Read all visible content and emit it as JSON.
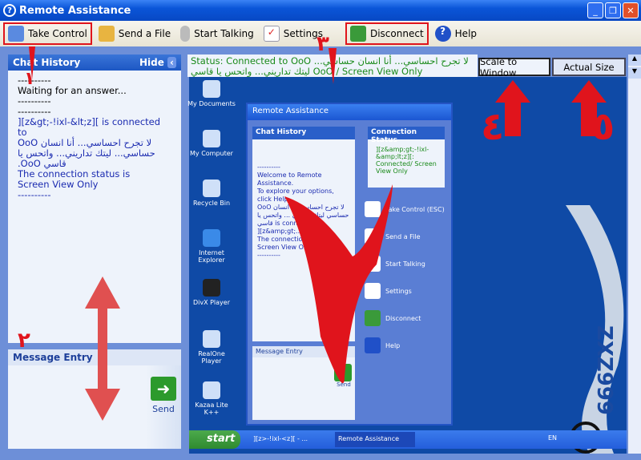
{
  "window": {
    "title": "Remote Assistance"
  },
  "toolbar": {
    "items": [
      {
        "label": "Take Control",
        "icon": "take-control-icon"
      },
      {
        "label": "Send a File",
        "icon": "send-file-icon"
      },
      {
        "label": "Start Talking",
        "icon": "microphone-icon"
      },
      {
        "label": "Settings",
        "icon": "settings-icon"
      },
      {
        "label": "Disconnect",
        "icon": "disconnect-icon"
      },
      {
        "label": "Help",
        "icon": "help-icon"
      }
    ]
  },
  "chat": {
    "title": "Chat History",
    "hide": "Hide",
    "lines": [
      "----------",
      "Waiting for an answer...",
      "----------",
      "----------"
    ],
    "blue_lines": [
      "][z&gt;-!ixl-&lt;z][ is connected to",
      "لا تجرح احساسي... أنا انسان OoO",
      "حساسي... ليتك تداريني... واتحس يا",
      "قاسي OoO.",
      "The connection status is",
      "Screen View Only"
    ],
    "end": "----------"
  },
  "message_entry": {
    "title": "Message Entry",
    "send": "Send"
  },
  "status": {
    "text": "Status: Connected to OoO لا تجرح احساسي... أنا انسان حساسي... ليتك تداريني... واتحس يا قاسي OoO / Screen View Only"
  },
  "view": {
    "scale": "Scale to Window",
    "actual": "Actual Size"
  },
  "desktop": {
    "icons": [
      "My Documents",
      "My Computer",
      "Recycle Bin",
      "Internet Explorer",
      "DivX Player",
      "RealOne Player",
      "Kazaa Lite K++"
    ]
  },
  "inner": {
    "title": "Remote Assistance",
    "chat_title": "Chat History",
    "chat_text": "----------\nWelcome to Remote Assistance.\nTo explore your options, click Help.\nOoO لا تجرح احساسي أنا انسان حساسي ليتك تداريني ... واتحس يا قاسي is connected to\n][z&amp;gt;...\nThe connection status is\nScreen View Only\n----------",
    "status_title": "Connection Status",
    "status_text": "][z&amp;gt;-!ixl-&amp;lt;z][: Connected/ Screen View Only",
    "buttons": [
      "Take Control (ESC)",
      "Send a File",
      "Start Talking",
      "Settings",
      "Disconnect",
      "Help"
    ],
    "msg_title": "Message Entry",
    "send": "Send"
  },
  "taskbar": {
    "start": "start",
    "tasks": [
      "][z>-!ixl-<z][ - ...",
      "Remote Assistance"
    ],
    "lang": "EN"
  },
  "annotations": [
    "١",
    "٢",
    "٣",
    "٤",
    "٥"
  ],
  "colors": {
    "accent": "#0a55d8",
    "annotation": "#e0141c",
    "status": "#1a8a1a"
  }
}
